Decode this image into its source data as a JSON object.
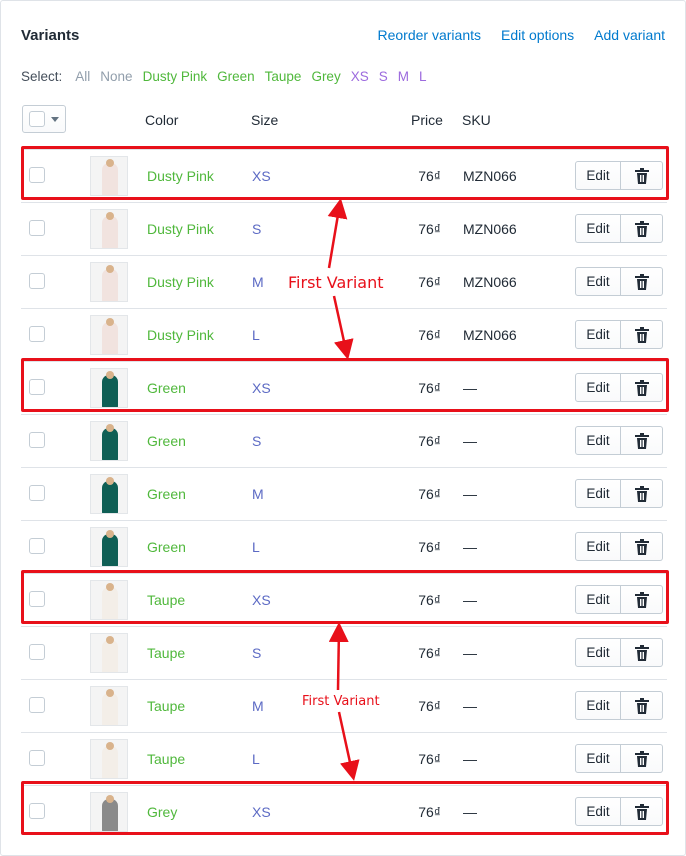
{
  "header": {
    "title": "Variants",
    "links": [
      "Reorder variants",
      "Edit options",
      "Add variant"
    ]
  },
  "select": {
    "label": "Select:",
    "options": [
      {
        "label": "All",
        "color": "#919eab"
      },
      {
        "label": "None",
        "color": "#919eab"
      },
      {
        "label": "Dusty Pink",
        "color": "#50b83c"
      },
      {
        "label": "Green",
        "color": "#50b83c"
      },
      {
        "label": "Taupe",
        "color": "#50b83c"
      },
      {
        "label": "Grey",
        "color": "#50b83c"
      },
      {
        "label": "XS",
        "color": "#9c6ade"
      },
      {
        "label": "S",
        "color": "#9c6ade"
      },
      {
        "label": "M",
        "color": "#9c6ade"
      },
      {
        "label": "L",
        "color": "#9c6ade"
      }
    ]
  },
  "table": {
    "columns": {
      "color": "Color",
      "size": "Size",
      "price": "Price",
      "sku": "SKU"
    },
    "edit_label": "Edit",
    "rows": [
      {
        "color": "Dusty Pink",
        "size": "XS",
        "price": "76₫",
        "sku": "MZN066",
        "swatch": "#f1e3df"
      },
      {
        "color": "Dusty Pink",
        "size": "S",
        "price": "76₫",
        "sku": "MZN066",
        "swatch": "#f1e3df"
      },
      {
        "color": "Dusty Pink",
        "size": "M",
        "price": "76₫",
        "sku": "MZN066",
        "swatch": "#f1e3df"
      },
      {
        "color": "Dusty Pink",
        "size": "L",
        "price": "76₫",
        "sku": "MZN066",
        "swatch": "#f1e3df"
      },
      {
        "color": "Green",
        "size": "XS",
        "price": "76₫",
        "sku": "—",
        "swatch": "#0f5f55"
      },
      {
        "color": "Green",
        "size": "S",
        "price": "76₫",
        "sku": "—",
        "swatch": "#0f5f55"
      },
      {
        "color": "Green",
        "size": "M",
        "price": "76₫",
        "sku": "—",
        "swatch": "#0f5f55"
      },
      {
        "color": "Green",
        "size": "L",
        "price": "76₫",
        "sku": "—",
        "swatch": "#0f5f55"
      },
      {
        "color": "Taupe",
        "size": "XS",
        "price": "76₫",
        "sku": "—",
        "swatch": "#f3eee8"
      },
      {
        "color": "Taupe",
        "size": "S",
        "price": "76₫",
        "sku": "—",
        "swatch": "#f3eee8"
      },
      {
        "color": "Taupe",
        "size": "M",
        "price": "76₫",
        "sku": "—",
        "swatch": "#f3eee8"
      },
      {
        "color": "Taupe",
        "size": "L",
        "price": "76₫",
        "sku": "—",
        "swatch": "#f3eee8"
      },
      {
        "color": "Grey",
        "size": "XS",
        "price": "76₫",
        "sku": "—",
        "swatch": "#8a8a8a"
      }
    ]
  },
  "annotations": {
    "label_1": "First Variant",
    "label_2": "First Variant",
    "color": "#e8101a"
  }
}
